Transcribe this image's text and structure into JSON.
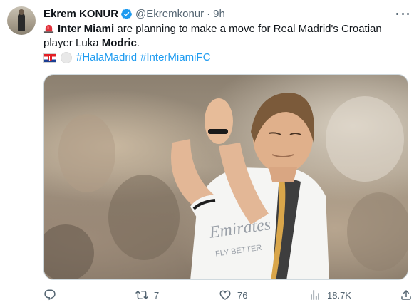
{
  "tweet": {
    "author_name": "Ekrem KONUR",
    "handle": "@Ekremkonur",
    "separator": "·",
    "time": "9h",
    "text_part1": "Inter Miami",
    "text_part2": " are planning to make a move for Real Madrid's Croatian player Luka ",
    "text_part3": "Modric",
    "text_part4": ".",
    "hashtags": [
      "#HalaMadrid",
      "#InterMiamiFC"
    ],
    "image_text": [
      "Emirates",
      "FLY BETTER"
    ]
  },
  "actions": {
    "replies": "",
    "retweets": "7",
    "likes": "76",
    "views": "18.7K"
  },
  "colors": {
    "text": "#0f1419",
    "secondary": "#536471",
    "link": "#1d9bf0",
    "verified": "#1d9bf0"
  },
  "icons": [
    "siren-icon",
    "croatia-flag-icon",
    "white-circle-icon",
    "verified-badge-icon",
    "more-icon",
    "reply-icon",
    "retweet-icon",
    "like-icon",
    "views-icon",
    "share-icon"
  ]
}
